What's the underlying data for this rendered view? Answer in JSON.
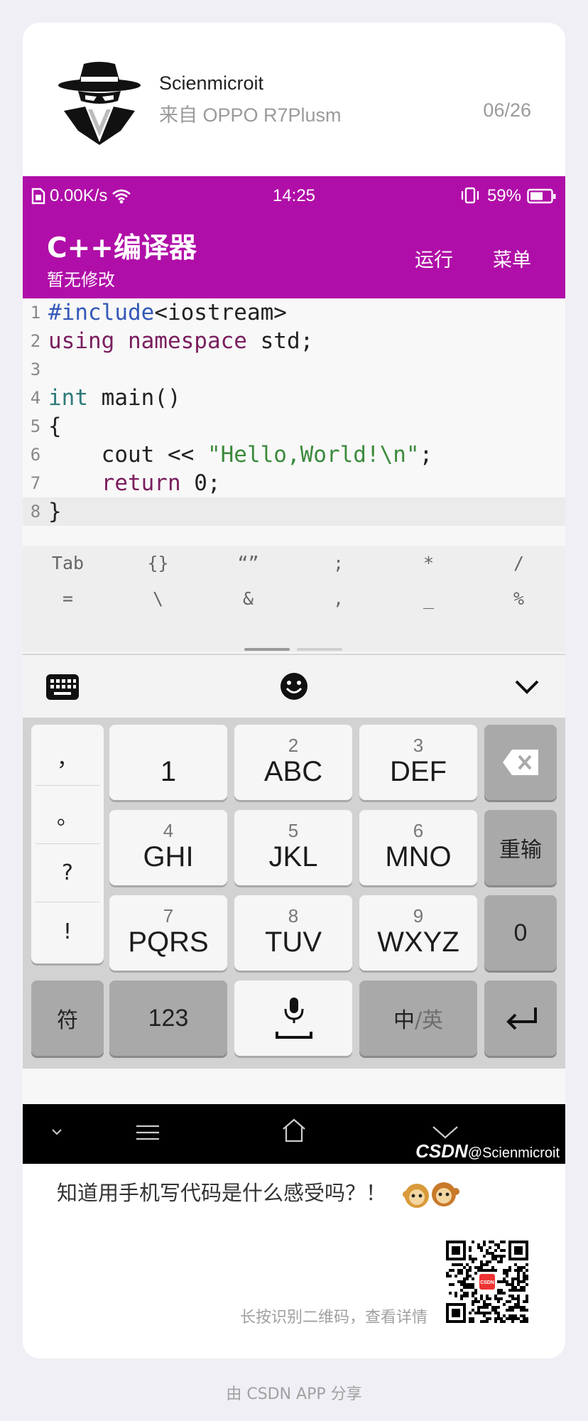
{
  "author": {
    "name": "Scienmicroit",
    "device": "来自 OPPO R7Plusm",
    "date": "06/26"
  },
  "status_bar": {
    "speed": "0.00K/s",
    "time": "14:25",
    "battery": "59%"
  },
  "app": {
    "title": "C++编译器",
    "subtitle": "暂无修改",
    "run": "运行",
    "menu": "菜单"
  },
  "code_lines": [
    {
      "n": "1",
      "parts": [
        {
          "t": "#include",
          "c": "kw-b"
        },
        {
          "t": "<iostream>",
          "c": ""
        }
      ]
    },
    {
      "n": "2",
      "parts": [
        {
          "t": "using namespace",
          "c": "kw-p"
        },
        {
          "t": " std;",
          "c": ""
        }
      ]
    },
    {
      "n": "3",
      "parts": []
    },
    {
      "n": "4",
      "parts": [
        {
          "t": "int",
          "c": "kw-t"
        },
        {
          "t": " main()",
          "c": ""
        }
      ]
    },
    {
      "n": "5",
      "parts": [
        {
          "t": "{",
          "c": ""
        }
      ]
    },
    {
      "n": "6",
      "parts": [
        {
          "t": "    cout << ",
          "c": ""
        },
        {
          "t": "\"Hello,World!\\n\"",
          "c": "str"
        },
        {
          "t": ";",
          "c": ""
        }
      ]
    },
    {
      "n": "7",
      "parts": [
        {
          "t": "    ",
          "c": ""
        },
        {
          "t": "return",
          "c": "kw-p"
        },
        {
          "t": " 0;",
          "c": ""
        }
      ]
    },
    {
      "n": "8",
      "parts": [
        {
          "t": "}",
          "c": ""
        }
      ]
    }
  ],
  "symbols_row1": [
    "Tab",
    "{}",
    "“”",
    ";",
    "*",
    "/"
  ],
  "symbols_row2": [
    "=",
    "\\",
    "&",
    ",",
    "_",
    "%"
  ],
  "punct_keys": [
    "，",
    "。",
    "?",
    "!"
  ],
  "keys": {
    "k1": {
      "num": "",
      "big": "1"
    },
    "k2": {
      "num": "2",
      "big": "ABC"
    },
    "k3": {
      "num": "3",
      "big": "DEF"
    },
    "k4": {
      "num": "4",
      "big": "GHI"
    },
    "k5": {
      "num": "5",
      "big": "JKL"
    },
    "k6": {
      "num": "6",
      "big": "MNO"
    },
    "k7": {
      "num": "7",
      "big": "PQRS"
    },
    "k8": {
      "num": "8",
      "big": "TUV"
    },
    "k9": {
      "num": "9",
      "big": "WXYZ"
    },
    "retype": "重输",
    "zero": "0",
    "fu": "符",
    "num123": "123",
    "zh": "中",
    "en": "/英"
  },
  "watermark": {
    "brand": "CSDN",
    "handle": "@Scienmicroit"
  },
  "post_text": "知道用手机写代码是什么感受吗？！",
  "qr_tip": "长按识别二维码，查看详情",
  "qr_label": "CSDN",
  "footer": "由 CSDN APP 分享",
  "colors": {
    "brand": "#b00ea8",
    "keyword_blue": "#3559b8",
    "keyword_purple": "#7a1e5e",
    "keyword_teal": "#2e7a7a",
    "string_green": "#3b8a3b"
  }
}
